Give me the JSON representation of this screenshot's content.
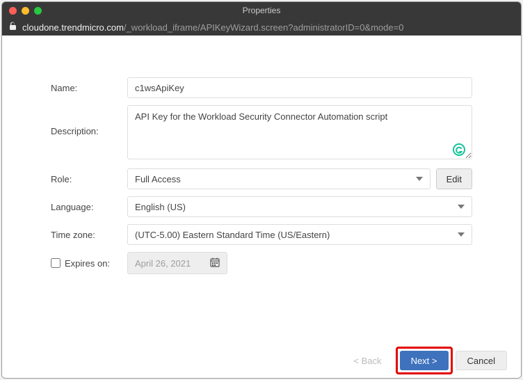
{
  "window": {
    "title": "Properties"
  },
  "url": {
    "host": "cloudone.trendmicro.com",
    "path": "/_workload_iframe/APIKeyWizard.screen?administratorID=0&mode=0"
  },
  "labels": {
    "name": "Name:",
    "description": "Description:",
    "role": "Role:",
    "language": "Language:",
    "timezone": "Time zone:",
    "expires": "Expires on:"
  },
  "fields": {
    "name_value": "c1wsApiKey",
    "description_value": "API Key for the Workload Security Connector Automation script",
    "role_value": "Full Access",
    "language_value": "English (US)",
    "timezone_value": "(UTC-5.00) Eastern Standard Time (US/Eastern)",
    "expires_date": "April 26, 2021"
  },
  "buttons": {
    "edit": "Edit",
    "back": "< Back",
    "next": "Next >",
    "cancel": "Cancel"
  }
}
